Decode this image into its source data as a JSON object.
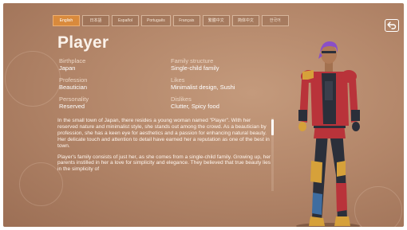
{
  "languages": [
    "English",
    "日本語",
    "Español",
    "Português",
    "Français",
    "繁體中文",
    "简体中文",
    "한국어"
  ],
  "active_language_index": 0,
  "character": {
    "name": "Player",
    "attributes": {
      "birthplace": {
        "label": "Birthplace",
        "value": "Japan"
      },
      "profession": {
        "label": "Profession",
        "value": "Beautician"
      },
      "personality": {
        "label": "Personality",
        "value": "Reserved"
      },
      "family": {
        "label": "Family structure",
        "value": "Single-child family"
      },
      "likes": {
        "label": "Likes",
        "value": "Minimalist design, Sushi"
      },
      "dislikes": {
        "label": "Dislikes",
        "value": "Clutter, Spicy food"
      }
    },
    "bio": [
      "In the small town of Japan, there resides a young woman named \"Player\". With her reserved nature and minimalist style, she stands out among the crowd. As a beautician by profession, she has a keen eye for aesthetics and a passion for enhancing natural beauty. Her delicate touch and attention to detail have earned her a reputation as one of the best in town.",
      "Player's family consists of just her, as she comes from a single-child family. Growing up, her parents instilled in her a love for simplicity and elegance. They believed that true beauty lies in the simplicity of"
    ]
  },
  "icons": {
    "back": "back-arrow-icon"
  },
  "colors": {
    "background": "#b4876a",
    "active_tab": "#d98a3c",
    "hair": "#8a4fc8",
    "jacket": "#b9333a",
    "armor_gold": "#d6a13a",
    "suit_dark": "#2b2f3a"
  }
}
